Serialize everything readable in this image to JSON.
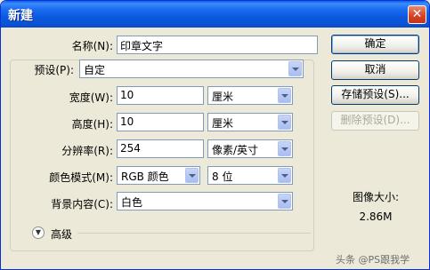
{
  "window": {
    "title": "新建",
    "close": "✕"
  },
  "form": {
    "name": {
      "label": "名称(N):",
      "value": "印章文字"
    },
    "preset": {
      "label": "预设(P):",
      "value": "自定"
    },
    "width": {
      "label": "宽度(W):",
      "value": "10",
      "unit": "厘米"
    },
    "height": {
      "label": "高度(H):",
      "value": "10",
      "unit": "厘米"
    },
    "resolution": {
      "label": "分辨率(R):",
      "value": "254",
      "unit": "像素/英寸"
    },
    "color_mode": {
      "label": "颜色模式(M):",
      "value": "RGB 颜色",
      "depth": "8 位"
    },
    "background": {
      "label": "背景内容(C):",
      "value": "白色"
    },
    "advanced": {
      "label": "高级"
    }
  },
  "buttons": {
    "ok": "确定",
    "cancel": "取消",
    "save_preset": "存储预设(S)...",
    "delete_preset": "删除预设(D)..."
  },
  "image_size": {
    "label": "图像大小:",
    "value": "2.86M"
  },
  "watermark": "头条 @PS跟我学"
}
